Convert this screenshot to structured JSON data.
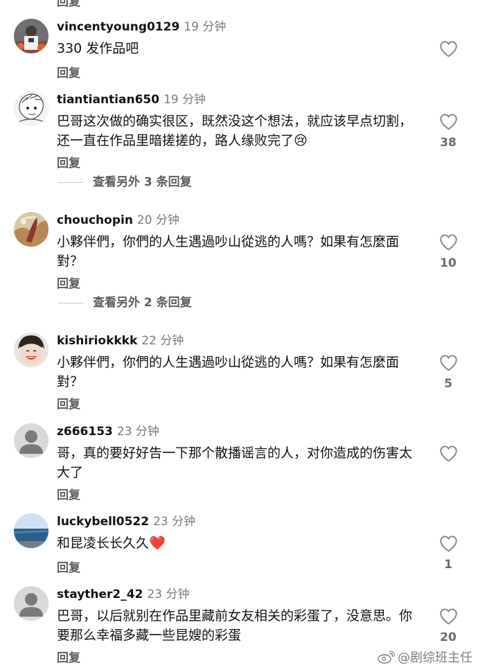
{
  "app": {
    "reply_label": "回复"
  },
  "top_reply": "回复",
  "comments": [
    {
      "username": "vincentyoung0129",
      "time": "19 分钟",
      "text": "330 发作品吧",
      "likes": "",
      "avatar_icon": "basketball-player-avatar"
    },
    {
      "username": "tiantiantian650",
      "time": "19 分钟",
      "text": "巴哥这次做的确实很区，既然没这个想法，就应该早点切割，还一直在作品里暗搓搓的，路人缘败完了😢",
      "likes": "38",
      "more_replies": "查看另外 3 条回复",
      "avatar_icon": "anime-character-avatar"
    },
    {
      "username": "chouchopin",
      "time": "20 分钟",
      "text": "小夥伴們，你們的人生遇過吵山從逃的人嗎？如果有怎麼面對？",
      "likes": "10",
      "more_replies": "查看另外 2 条回复",
      "avatar_icon": "painting-avatar"
    },
    {
      "username": "kishiriokkkk",
      "time": "22 分钟",
      "text": "小夥伴們，你們的人生遇過吵山從逃的人嗎？如果有怎麼面對？",
      "likes": "5",
      "avatar_icon": "smiling-child-avatar"
    },
    {
      "username": "z666153",
      "time": "23 分钟",
      "text": "哥，真的要好好告一下那个散播谣言的人，对你造成的伤害太大了",
      "likes": "",
      "avatar_icon": "default-user-avatar"
    },
    {
      "username": "luckybell0522",
      "time": "23 分钟",
      "text": "和昆凌长长久久❤️",
      "likes": "1",
      "avatar_icon": "ocean-landscape-avatar"
    },
    {
      "username": "stayther2_42",
      "time": "23 分钟",
      "text": "巴哥，以后就别在作品里藏前女友相关的彩蛋了，没意思。你要那么幸福多藏一些昆嫂的彩蛋",
      "likes": "20",
      "avatar_icon": "default-user-avatar"
    }
  ],
  "watermark": "@剧综班主任",
  "colors": {
    "text": "#121212",
    "secondary": "#7a7a7a",
    "reply": "#5c5c5c",
    "heart_outline": "#8a8a8a"
  }
}
